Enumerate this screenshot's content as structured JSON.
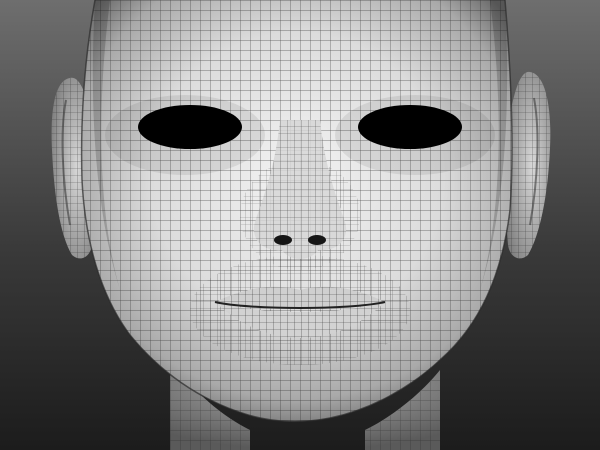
{
  "viewport": {
    "background_top": "#6e6e6e",
    "background_bottom": "#1c1c1c",
    "surface_color": "#e4e4e4",
    "wireframe_color": "#1f1f1f"
  }
}
